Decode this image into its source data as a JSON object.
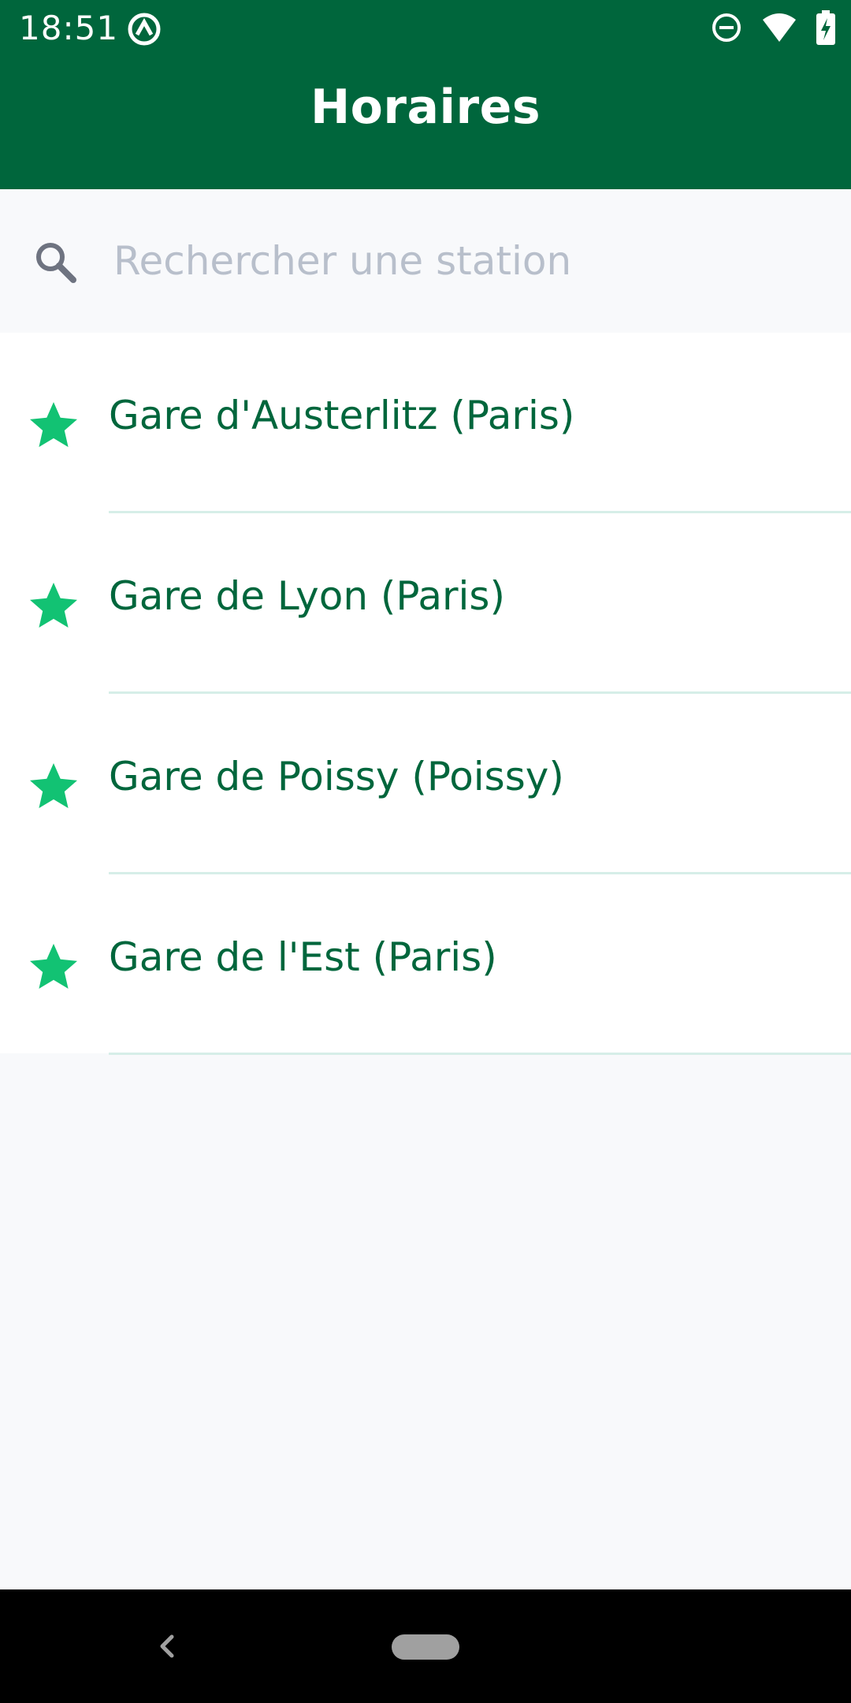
{
  "status_bar": {
    "time": "18:51",
    "icons": [
      "app-notification-icon",
      "do-not-disturb-icon",
      "wifi-icon",
      "battery-charging-icon"
    ]
  },
  "app_bar": {
    "title": "Horaires",
    "background_color": "#00663C"
  },
  "search": {
    "placeholder": "Rechercher une station",
    "value": ""
  },
  "stations": [
    {
      "label": "Gare d'Austerlitz (Paris)",
      "favorite": true
    },
    {
      "label": "Gare de Lyon (Paris)",
      "favorite": true
    },
    {
      "label": "Gare de Poissy (Poissy)",
      "favorite": true
    },
    {
      "label": "Gare de l'Est (Paris)",
      "favorite": true
    }
  ],
  "colors": {
    "accent": "#00663C",
    "star": "#12C273",
    "divider": "#D6EEE8",
    "background": "#F8F9FB"
  },
  "nav_bar": {
    "buttons": [
      "back",
      "home"
    ]
  }
}
